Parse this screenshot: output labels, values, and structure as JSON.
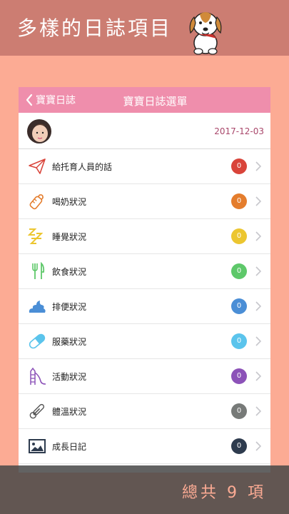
{
  "banner": {
    "title": "多樣的日誌項目"
  },
  "nav": {
    "back_label": "寶寶日誌",
    "title": "寶寶日誌選單"
  },
  "profile": {
    "date": "2017-12-03"
  },
  "items": [
    {
      "label": "給托育人員的話",
      "count": "0",
      "icon": "paper-plane-icon",
      "color": "#d9443a"
    },
    {
      "label": "喝奶狀況",
      "count": "0",
      "icon": "baby-bottle-icon",
      "color": "#e47d2d"
    },
    {
      "label": "睡覺狀況",
      "count": "0",
      "icon": "sleep-zzz-icon",
      "color": "#ecc630"
    },
    {
      "label": "飲食狀況",
      "count": "0",
      "icon": "fork-knife-icon",
      "color": "#5ec86a"
    },
    {
      "label": "排便狀況",
      "count": "0",
      "icon": "poop-icon",
      "color": "#4a8ed6"
    },
    {
      "label": "服藥狀況",
      "count": "0",
      "icon": "pill-icon",
      "color": "#5bc4ec"
    },
    {
      "label": "活動狀況",
      "count": "0",
      "icon": "slide-icon",
      "color": "#8c52b8"
    },
    {
      "label": "體溫狀況",
      "count": "0",
      "icon": "thermometer-icon",
      "color": "#777a78"
    },
    {
      "label": "成長日記",
      "count": "0",
      "icon": "photo-icon",
      "color": "#2e3b4e"
    }
  ],
  "footer": {
    "text": "總共 9 項"
  }
}
